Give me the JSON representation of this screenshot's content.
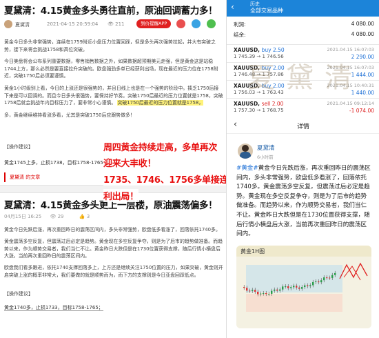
{
  "article1": {
    "title": "夏黛清：4.15黄金多头勇往直前，原油回调蓄力多！",
    "author": "夏黛清",
    "date": "2021-04-15 20:59:04",
    "views": "211",
    "app_button": "到价提醒APP",
    "paragraphs": [
      "黄金今日多头非常强势，连续在1759附近小盘压力位置回踩，但是多头再次强势拉起，并大有突破之势，接下来将会挑战1758和高位突破。",
      "今日美盘将会公布系列重要数据，零售销售数据之外，如果数据超预期美元走强，但是黄金这是站稳1744上方，那么必然是要直接拉升突破的。欧盘强劲多单已经获利出场，现在最近的压力位在1758附近，突破1750后必须要谨慎。",
      "黄金1小时级别上看，今日的上涨还是很强势的，并且日线上也是在一个强势的阶段中。揍乏1750后接下来是可以回调的。而且今日多头很强势，要保持好节奏。突破1750后最近的压力位置就是1758，突破1758后就会挑战年内目标压力了，要非常小心谨慎。",
      "多，黄金继续维持看涨多看，尤其是突破1750后应跟势做多！"
    ],
    "highlight": "突破1750后最近的压力位置就是1758，",
    "tips_label": "【操作建议】",
    "trade": "黄金1745上多，止损1738，目标1758-1765；",
    "tag": "夏黛清 的文章"
  },
  "article2": {
    "title": "夏黛清：4.15黄金多头更上一层楼，原油震荡偏多！",
    "date": "04月15日 16:25",
    "views": "29",
    "likes": "3",
    "paragraphs": [
      "黄金今日先跌后涨，再次重回昨日的震荡区间内，多头非常强势，欧盘低多看涨了，回落依托1740多。",
      "黄金震荡多空反复，但震荡过后必定是趋势。黄金现在多空反复争夺，则是为了后市的趋势做准备。而趋势以来，作为顺势交易者，我们当仁不让。黄金昨日大跌但是在1730位置获得支撑，随后行情小横盘后大涨，当前再次重回昨日的震荡区间内。",
      "欧盘我们看多跟进，依托1740支撑回落多上，上方还是继续关注1750位置的压力，如果突破，黄金则开启突破上涨的概率非常大，我们要做的就是顺势而为，而下方的支撑则是今日亚盘回踩低点。"
    ],
    "tips_label": "【操作建议】",
    "trade": "黄金1740多，止损1733，目标1758-1765；"
  },
  "overlay": {
    "line1": "周四黄金持续走高，多单再次",
    "line2": "迎来大丰收！",
    "line3": "1735、1746、1756多单接连盈",
    "line4": "利出局！"
  },
  "app": {
    "back_icon": "‹",
    "subtitle": "历史",
    "title": "全部交易品种",
    "summary": [
      {
        "label": "利润:",
        "value": "4 080.00"
      },
      {
        "label": "结余:",
        "value": "4 080.00"
      }
    ],
    "orders": [
      {
        "symbol": "XAUUSD,",
        "side": "buy 2.50",
        "dir": "buy",
        "prices": "1 745.39 → 1 746.56",
        "time": "2021.04.15 16:07:03",
        "pl": "2 290.00",
        "pl_sign": "pos"
      },
      {
        "symbol": "XAUUSD,",
        "side": "buy 2.00",
        "dir": "buy",
        "prices": "1 746.48 → 1 757.86",
        "time": "2021.04.15 16:07:03",
        "pl": "1 444.00",
        "pl_sign": "pos"
      },
      {
        "symbol": "XAUUSD,",
        "side": "buy 2.00",
        "dir": "buy",
        "prices": "1 756.03 → 1 763.43",
        "time": "2021.04.15 10:40:31",
        "pl": "1 440.00",
        "pl_sign": "pos"
      },
      {
        "symbol": "XAUUSD,",
        "side": "sell 2.00",
        "dir": "sell",
        "prices": "1 757.30 → 1 768.75",
        "time": "2021.04.15 09:12:14",
        "pl": "-1 074.00",
        "pl_sign": "neg"
      }
    ],
    "watermark": "夏黛清"
  },
  "detail": {
    "back_icon": "‹",
    "title": "详情",
    "user": "夏黛清",
    "time": "6小时前",
    "tag": "#黄金#",
    "text": "黄金今日先跌后涨，再次重回昨日的震荡区间内，多头非常强势，欧盘低多看涨了，回落依托1740多。黄金震荡多空反复，但震荡过后必定是趋势。黄金现在多空反复争夺，则是为了后市的趋势做准备。而趋势以来，作为顺势交易者，我们当仁不让。黄金昨日大跌但是在1730位置获得支撑，随后行情小横盘后大涨，当前再次重回昨日的震荡区间内。",
    "chart_label": "黄金1H图"
  },
  "colors": {
    "accent": "#1c84d9",
    "overlay_red": "#e81010",
    "buy": "#1c6fd6",
    "sell": "#d22222"
  }
}
